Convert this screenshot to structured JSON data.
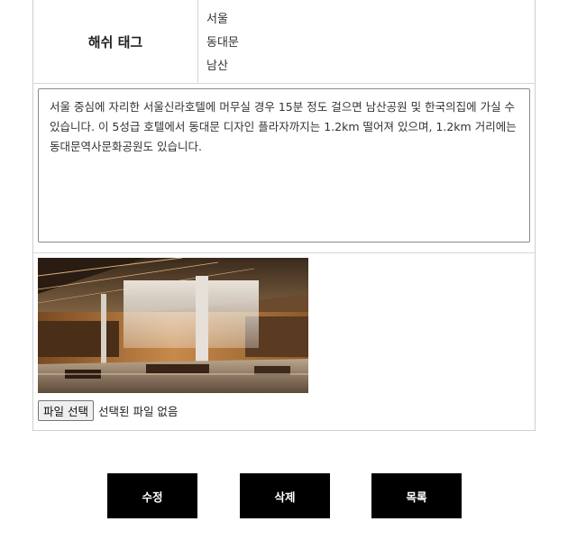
{
  "hashtag": {
    "label": "해쉬 태그",
    "tags": [
      "서울",
      "동대문",
      "남산"
    ]
  },
  "description": {
    "text": "서울 중심에 자리한 서울신라호텔에 머무실 경우 15분 정도 걸으면 남산공원 및 한국의집에 가실 수 있습니다. 이 5성급 호텔에서 동대문 디자인 플라자까지는 1.2km 떨어져 있으며, 1.2km 거리에는 동대문역사문화공원도 있습니다."
  },
  "file_input": {
    "button_label": "파일 선택",
    "status": "선택된 파일 없음"
  },
  "actions": {
    "edit_label": "수정",
    "delete_label": "삭제",
    "list_label": "목록"
  }
}
